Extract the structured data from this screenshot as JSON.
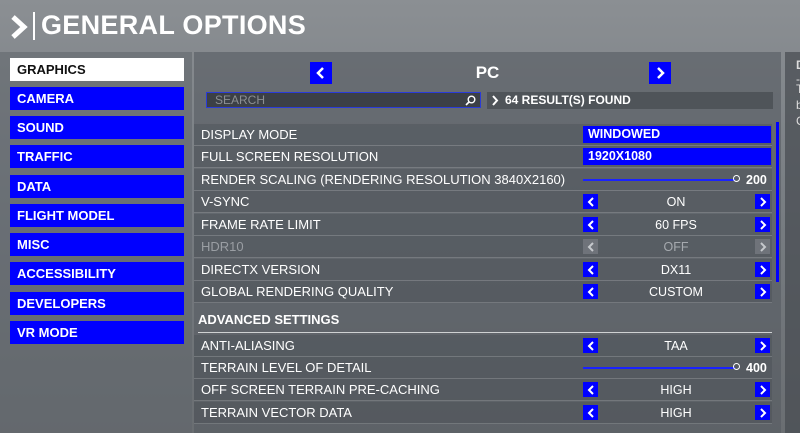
{
  "header": {
    "title": "GENERAL OPTIONS"
  },
  "sidebar": {
    "items": [
      {
        "label": "GRAPHICS"
      },
      {
        "label": "CAMERA"
      },
      {
        "label": "SOUND"
      },
      {
        "label": "TRAFFIC"
      },
      {
        "label": "DATA"
      },
      {
        "label": "FLIGHT MODEL"
      },
      {
        "label": "MISC"
      },
      {
        "label": "ACCESSIBILITY"
      },
      {
        "label": "DEVELOPERS"
      },
      {
        "label": "VR MODE"
      }
    ]
  },
  "platform": {
    "name": "PC"
  },
  "search": {
    "placeholder": "SEARCH",
    "results": "64 RESULT(S) FOUND"
  },
  "settings": [
    {
      "label": "DISPLAY MODE",
      "value": "WINDOWED"
    },
    {
      "label": "FULL SCREEN RESOLUTION",
      "value": "1920X1080"
    },
    {
      "label": "RENDER SCALING (RENDERING RESOLUTION 3840X2160)",
      "value": "200"
    },
    {
      "label": "V-SYNC",
      "value": "ON"
    },
    {
      "label": "FRAME RATE LIMIT",
      "value": "60 FPS"
    },
    {
      "label": "HDR10",
      "value": "OFF"
    },
    {
      "label": "DIRECTX VERSION",
      "value": "DX11"
    },
    {
      "label": "GLOBAL RENDERING QUALITY",
      "value": "CUSTOM"
    }
  ],
  "advanced": {
    "title": "ADVANCED SETTINGS",
    "settings": [
      {
        "label": "ANTI-ALIASING",
        "value": "TAA"
      },
      {
        "label": "TERRAIN LEVEL OF DETAIL",
        "value": "400"
      },
      {
        "label": "OFF SCREEN TERRAIN PRE-CACHING",
        "value": "HIGH"
      },
      {
        "label": "TERRAIN VECTOR DATA",
        "value": "HIGH"
      }
    ]
  },
  "right_panel": {
    "fragments": [
      "D",
      "-",
      "T",
      "b",
      "C"
    ]
  },
  "colors": {
    "accent": "#0000ff",
    "active_bg": "#ffffff"
  }
}
